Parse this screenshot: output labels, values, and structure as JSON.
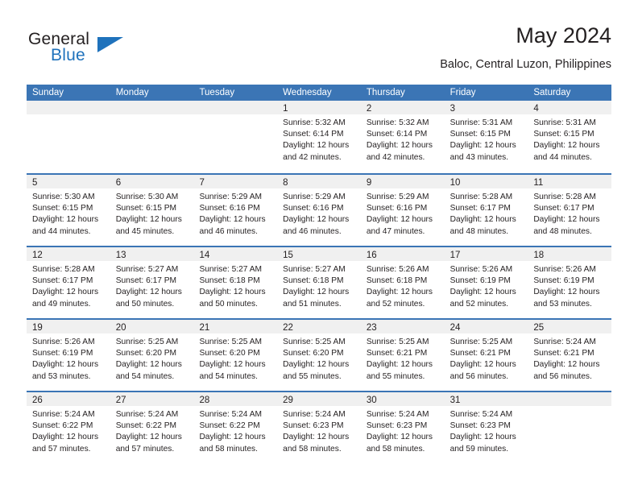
{
  "logo": {
    "word_top": "General",
    "word_bottom": "Blue",
    "triangle_color": "#1f72bc",
    "text_color": "#231f20"
  },
  "header": {
    "title": "May 2024",
    "subtitle": "Baloc, Central Luzon, Philippines"
  },
  "theme": {
    "header_blue": "#3b75b5",
    "day_band_gray": "#f0f0f0",
    "text": "#231f20"
  },
  "weekday_headers": [
    "Sunday",
    "Monday",
    "Tuesday",
    "Wednesday",
    "Thursday",
    "Friday",
    "Saturday"
  ],
  "weeks": [
    [
      {
        "day": "",
        "empty": true
      },
      {
        "day": "",
        "empty": true
      },
      {
        "day": "",
        "empty": true
      },
      {
        "day": "1",
        "sunrise": "Sunrise: 5:32 AM",
        "sunset": "Sunset: 6:14 PM",
        "daylight1": "Daylight: 12 hours",
        "daylight2": "and 42 minutes."
      },
      {
        "day": "2",
        "sunrise": "Sunrise: 5:32 AM",
        "sunset": "Sunset: 6:14 PM",
        "daylight1": "Daylight: 12 hours",
        "daylight2": "and 42 minutes."
      },
      {
        "day": "3",
        "sunrise": "Sunrise: 5:31 AM",
        "sunset": "Sunset: 6:15 PM",
        "daylight1": "Daylight: 12 hours",
        "daylight2": "and 43 minutes."
      },
      {
        "day": "4",
        "sunrise": "Sunrise: 5:31 AM",
        "sunset": "Sunset: 6:15 PM",
        "daylight1": "Daylight: 12 hours",
        "daylight2": "and 44 minutes."
      }
    ],
    [
      {
        "day": "5",
        "sunrise": "Sunrise: 5:30 AM",
        "sunset": "Sunset: 6:15 PM",
        "daylight1": "Daylight: 12 hours",
        "daylight2": "and 44 minutes."
      },
      {
        "day": "6",
        "sunrise": "Sunrise: 5:30 AM",
        "sunset": "Sunset: 6:15 PM",
        "daylight1": "Daylight: 12 hours",
        "daylight2": "and 45 minutes."
      },
      {
        "day": "7",
        "sunrise": "Sunrise: 5:29 AM",
        "sunset": "Sunset: 6:16 PM",
        "daylight1": "Daylight: 12 hours",
        "daylight2": "and 46 minutes."
      },
      {
        "day": "8",
        "sunrise": "Sunrise: 5:29 AM",
        "sunset": "Sunset: 6:16 PM",
        "daylight1": "Daylight: 12 hours",
        "daylight2": "and 46 minutes."
      },
      {
        "day": "9",
        "sunrise": "Sunrise: 5:29 AM",
        "sunset": "Sunset: 6:16 PM",
        "daylight1": "Daylight: 12 hours",
        "daylight2": "and 47 minutes."
      },
      {
        "day": "10",
        "sunrise": "Sunrise: 5:28 AM",
        "sunset": "Sunset: 6:17 PM",
        "daylight1": "Daylight: 12 hours",
        "daylight2": "and 48 minutes."
      },
      {
        "day": "11",
        "sunrise": "Sunrise: 5:28 AM",
        "sunset": "Sunset: 6:17 PM",
        "daylight1": "Daylight: 12 hours",
        "daylight2": "and 48 minutes."
      }
    ],
    [
      {
        "day": "12",
        "sunrise": "Sunrise: 5:28 AM",
        "sunset": "Sunset: 6:17 PM",
        "daylight1": "Daylight: 12 hours",
        "daylight2": "and 49 minutes."
      },
      {
        "day": "13",
        "sunrise": "Sunrise: 5:27 AM",
        "sunset": "Sunset: 6:17 PM",
        "daylight1": "Daylight: 12 hours",
        "daylight2": "and 50 minutes."
      },
      {
        "day": "14",
        "sunrise": "Sunrise: 5:27 AM",
        "sunset": "Sunset: 6:18 PM",
        "daylight1": "Daylight: 12 hours",
        "daylight2": "and 50 minutes."
      },
      {
        "day": "15",
        "sunrise": "Sunrise: 5:27 AM",
        "sunset": "Sunset: 6:18 PM",
        "daylight1": "Daylight: 12 hours",
        "daylight2": "and 51 minutes."
      },
      {
        "day": "16",
        "sunrise": "Sunrise: 5:26 AM",
        "sunset": "Sunset: 6:18 PM",
        "daylight1": "Daylight: 12 hours",
        "daylight2": "and 52 minutes."
      },
      {
        "day": "17",
        "sunrise": "Sunrise: 5:26 AM",
        "sunset": "Sunset: 6:19 PM",
        "daylight1": "Daylight: 12 hours",
        "daylight2": "and 52 minutes."
      },
      {
        "day": "18",
        "sunrise": "Sunrise: 5:26 AM",
        "sunset": "Sunset: 6:19 PM",
        "daylight1": "Daylight: 12 hours",
        "daylight2": "and 53 minutes."
      }
    ],
    [
      {
        "day": "19",
        "sunrise": "Sunrise: 5:26 AM",
        "sunset": "Sunset: 6:19 PM",
        "daylight1": "Daylight: 12 hours",
        "daylight2": "and 53 minutes."
      },
      {
        "day": "20",
        "sunrise": "Sunrise: 5:25 AM",
        "sunset": "Sunset: 6:20 PM",
        "daylight1": "Daylight: 12 hours",
        "daylight2": "and 54 minutes."
      },
      {
        "day": "21",
        "sunrise": "Sunrise: 5:25 AM",
        "sunset": "Sunset: 6:20 PM",
        "daylight1": "Daylight: 12 hours",
        "daylight2": "and 54 minutes."
      },
      {
        "day": "22",
        "sunrise": "Sunrise: 5:25 AM",
        "sunset": "Sunset: 6:20 PM",
        "daylight1": "Daylight: 12 hours",
        "daylight2": "and 55 minutes."
      },
      {
        "day": "23",
        "sunrise": "Sunrise: 5:25 AM",
        "sunset": "Sunset: 6:21 PM",
        "daylight1": "Daylight: 12 hours",
        "daylight2": "and 55 minutes."
      },
      {
        "day": "24",
        "sunrise": "Sunrise: 5:25 AM",
        "sunset": "Sunset: 6:21 PM",
        "daylight1": "Daylight: 12 hours",
        "daylight2": "and 56 minutes."
      },
      {
        "day": "25",
        "sunrise": "Sunrise: 5:24 AM",
        "sunset": "Sunset: 6:21 PM",
        "daylight1": "Daylight: 12 hours",
        "daylight2": "and 56 minutes."
      }
    ],
    [
      {
        "day": "26",
        "sunrise": "Sunrise: 5:24 AM",
        "sunset": "Sunset: 6:22 PM",
        "daylight1": "Daylight: 12 hours",
        "daylight2": "and 57 minutes."
      },
      {
        "day": "27",
        "sunrise": "Sunrise: 5:24 AM",
        "sunset": "Sunset: 6:22 PM",
        "daylight1": "Daylight: 12 hours",
        "daylight2": "and 57 minutes."
      },
      {
        "day": "28",
        "sunrise": "Sunrise: 5:24 AM",
        "sunset": "Sunset: 6:22 PM",
        "daylight1": "Daylight: 12 hours",
        "daylight2": "and 58 minutes."
      },
      {
        "day": "29",
        "sunrise": "Sunrise: 5:24 AM",
        "sunset": "Sunset: 6:23 PM",
        "daylight1": "Daylight: 12 hours",
        "daylight2": "and 58 minutes."
      },
      {
        "day": "30",
        "sunrise": "Sunrise: 5:24 AM",
        "sunset": "Sunset: 6:23 PM",
        "daylight1": "Daylight: 12 hours",
        "daylight2": "and 58 minutes."
      },
      {
        "day": "31",
        "sunrise": "Sunrise: 5:24 AM",
        "sunset": "Sunset: 6:23 PM",
        "daylight1": "Daylight: 12 hours",
        "daylight2": "and 59 minutes."
      },
      {
        "day": "",
        "empty": true
      }
    ]
  ]
}
